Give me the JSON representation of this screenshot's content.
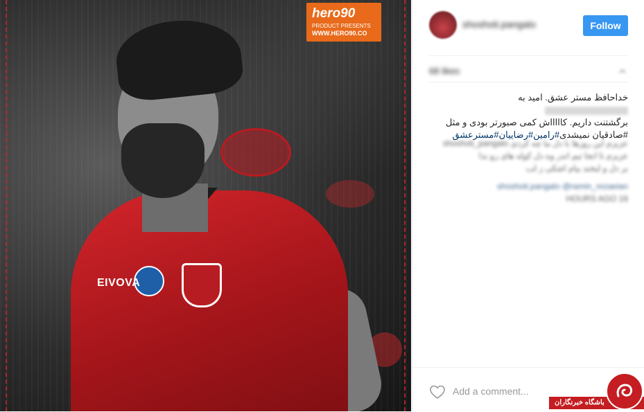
{
  "photo": {
    "hero_logo": {
      "brand": "hero90",
      "tagline": "PRODUCT PRESENTS",
      "url": "WWW.HERO90.CO"
    },
    "jersey_sponsor": "EIVOVA"
  },
  "header": {
    "username": "shoshoti.pangalo",
    "follow_label": "Follow"
  },
  "likes": "68 likes",
  "caption": {
    "line1": "خداحافظ مستر عشق. امید به",
    "line2": "برگشتنت داریم. کاااااش کمی صبورتر بودی و مثل",
    "line3_prefix": "#صادقیان نمیشدی",
    "hashtags": "#رامین#رضاییان#مسترعشق"
  },
  "comments": [
    {
      "text": "عزیزم این روزها با دل ما چه کردی shoshoti_pangalo"
    },
    {
      "text": "عزیزم تا انجا تیم اندر وه دل کوله های رو ندا"
    },
    {
      "text": "بر دل و لبخند بیام اشکی ز لب"
    }
  ],
  "comment_mention_row": "shoshoti.pangalo @ramin_rezaeian",
  "comment_time": "16 HOURS AGO",
  "comment_input": {
    "placeholder": "Add a comment..."
  },
  "watermark": {
    "text": "باشگاه خبرنگاران"
  },
  "colors": {
    "follow_blue": "#3897f0",
    "hashtag_blue": "#003569",
    "watermark_red": "#c41d22",
    "logo_orange": "#e86a1a"
  }
}
